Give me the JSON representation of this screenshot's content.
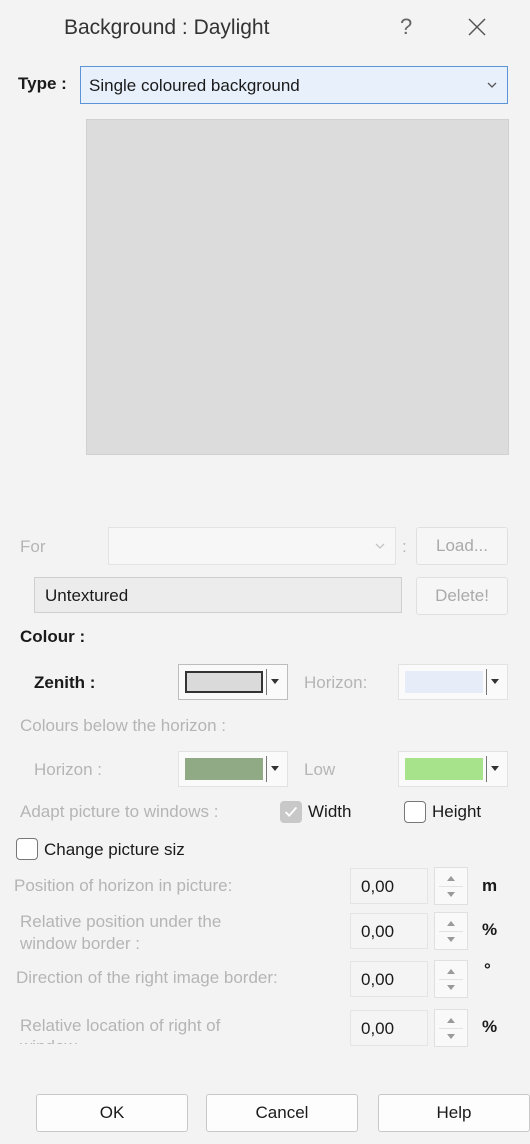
{
  "window": {
    "title": "Background : Daylight",
    "help_glyph": "?",
    "close_icon": "close-icon"
  },
  "type": {
    "label": "Type :",
    "value": "Single coloured background"
  },
  "texture": {
    "for_label": "For",
    "for_value": "",
    "separator": ":",
    "load_label": "Load...",
    "name_value": "Untextured",
    "delete_label": "Delete!"
  },
  "colour": {
    "heading": "Colour :",
    "zenith_label": "Zenith :",
    "zenith_color": "#dadada",
    "horizon_label": "Horizon:",
    "horizon_color": "#e6edf8",
    "below_heading": "Colours below the horizon :",
    "below_horizon_label": "Horizon :",
    "below_horizon_color": "#8faa85",
    "low_label": "Low",
    "low_color": "#a6e38a"
  },
  "adapt": {
    "label": "Adapt picture to windows :",
    "width_label": "Width",
    "width_checked": true,
    "height_label": "Height",
    "height_checked": false
  },
  "change_size": {
    "label": "Change picture siz",
    "checked": false
  },
  "params": [
    {
      "label": "Position of horizon in picture:",
      "value": "0,00",
      "unit": "m"
    },
    {
      "label_line1": "Relative position under the",
      "label_line2": "window border :",
      "value": "0,00",
      "unit": "%"
    },
    {
      "label": "Direction of the right image border:",
      "value": "0,00",
      "unit": "°"
    },
    {
      "label_line1": "Relative location of right of",
      "label_line2": "window",
      "value": "0,00",
      "unit": "%"
    }
  ],
  "footer": {
    "ok": "OK",
    "cancel": "Cancel",
    "help": "Help"
  }
}
